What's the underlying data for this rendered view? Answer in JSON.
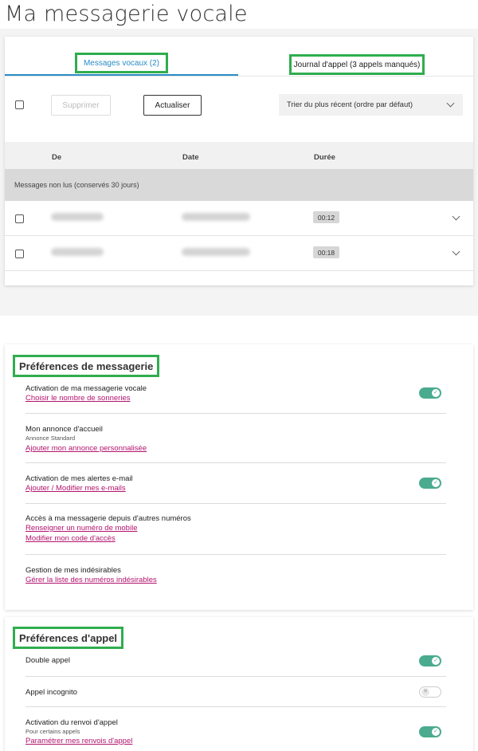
{
  "page": {
    "title": "Ma messagerie vocale"
  },
  "tabs": {
    "voice": "Messages vocaux (2)",
    "journal": "Journal d'appel (3 appels manqués)"
  },
  "toolbar": {
    "delete_label": "Supprimer",
    "refresh_label": "Actualiser",
    "sort_value": "Trier du plus récent (ordre par défaut)"
  },
  "table": {
    "columns": [
      "De",
      "Date",
      "Durée"
    ],
    "group_label": "Messages non lus (conservés 30 jours)",
    "rows": [
      {
        "duration": "00:12"
      },
      {
        "duration": "00:18"
      }
    ]
  },
  "prefs": {
    "title": "Préférences de messagerie",
    "items": [
      {
        "label": "Activation de ma messagerie vocale",
        "links": [
          "Choisir le nombre de sonneries"
        ],
        "toggle": true
      },
      {
        "label": "Mon annonce d'accueil",
        "sub": "Annonce Standard",
        "links": [
          "Ajouter mon annonce personnalisée"
        ]
      },
      {
        "label": "Activation de mes alertes e-mail",
        "links": [
          "Ajouter / Modifier mes e-mails"
        ],
        "toggle": true
      },
      {
        "label": "Accès à ma messagerie depuis d'autres numéros",
        "links": [
          "Renseigner un numéro de mobile",
          "Modifier mon code d'accès"
        ]
      },
      {
        "label": "Gestion de mes indésirables",
        "links": [
          "Gérer la liste des numéros indésirables"
        ]
      }
    ]
  },
  "call_prefs": {
    "title": "Préférences d'appel",
    "items": [
      {
        "label": "Double appel",
        "toggle": true
      },
      {
        "label": "Appel incognito",
        "toggle": false
      },
      {
        "label": "Activation du renvoi d'appel",
        "sub": "Pour certains appels",
        "links": [
          "Paramétrer mes renvois d'appel"
        ],
        "toggle": true
      }
    ]
  },
  "colors": {
    "accent_blue": "#2a8cc5",
    "link_magenta": "#b3136e",
    "toggle_green": "#4aab8f",
    "highlight_green": "#2fad4e"
  }
}
